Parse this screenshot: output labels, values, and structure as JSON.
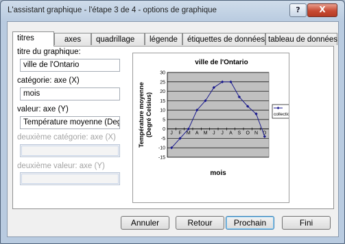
{
  "window": {
    "title": "L'assistant graphique - l'étape 3 de 4 -  options de graphique",
    "help_label": "?",
    "close_label": "X"
  },
  "tabs": [
    {
      "label": "titres",
      "active": true
    },
    {
      "label": "axes",
      "active": false
    },
    {
      "label": "quadrillage",
      "active": false
    },
    {
      "label": "légende",
      "active": false
    },
    {
      "label": "étiquettes de données",
      "active": false
    },
    {
      "label": "tableau de données",
      "active": false
    }
  ],
  "fields": {
    "chart_title": {
      "label": "titre du graphique:",
      "value": "ville de l'Ontario"
    },
    "category_x": {
      "label": "catégorie: axe (X)",
      "value": "mois"
    },
    "value_y": {
      "label": "valeur: axe (Y)",
      "value": "Température moyenne (Degré"
    },
    "second_category": {
      "label": "deuxième catégorie: axe (X)",
      "value": "",
      "enabled": false
    },
    "second_value": {
      "label": "deuxième valeur: axe (Y)",
      "value": "",
      "enabled": false
    }
  },
  "chart_data": {
    "type": "line",
    "title": "ville de l'Ontario",
    "xlabel": "mois",
    "ylabel_lines": [
      "Température moyenne",
      "(Degré Celsius)"
    ],
    "categories": [
      "J",
      "F",
      "M",
      "A",
      "M",
      "J",
      "J",
      "A",
      "S",
      "O",
      "N",
      "D"
    ],
    "series": [
      {
        "name": "collection 1",
        "values": [
          -10,
          -5,
          0,
          10,
          15,
          22,
          25,
          25,
          17,
          12,
          8,
          -4
        ]
      }
    ],
    "ylim": [
      -15,
      30
    ],
    "yticks": [
      -15,
      -10,
      -5,
      0,
      5,
      10,
      15,
      20,
      25,
      30
    ],
    "grid": true,
    "legend": "right",
    "colors": {
      "plot_bg": "#c0c0c0",
      "series": "#1a1a8c"
    }
  },
  "buttons": {
    "cancel": "Annuler",
    "back": "Retour",
    "next": "Prochain",
    "finish": "Fini"
  }
}
